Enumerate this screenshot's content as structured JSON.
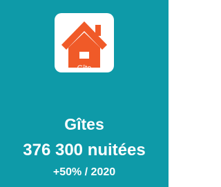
{
  "card": {
    "background_color": "#0e9aa8",
    "icon": {
      "name": "house-icon",
      "label": "Gîte",
      "color": "#f05a28",
      "background_color": "#ffffff"
    },
    "title": "Gîtes",
    "value": "376 300 nuitées",
    "change": "+50% / 2020"
  }
}
